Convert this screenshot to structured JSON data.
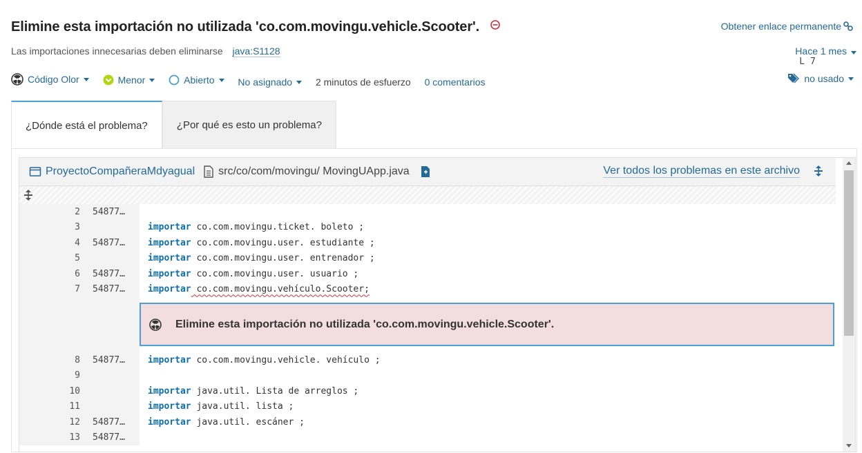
{
  "issue": {
    "title": "Elimine esta importación no utilizada 'co.com.movingu.vehicle.Scooter'.",
    "permalink_label": "Obtener enlace permanente",
    "description": "Las importaciones innecesarias deben eliminarse",
    "rule": "java:S1128",
    "date": "Hace 1 mes",
    "line": "L 7"
  },
  "meta": {
    "type": "Código Olor",
    "severity": "Menor",
    "status": "Abierto",
    "assignee": "No asignado",
    "effort": "2 minutos de esfuerzo",
    "comments": "0 comentarios",
    "tag": "no usado"
  },
  "tabs": [
    "¿Dónde está el problema?",
    "¿Por qué es esto un problema?"
  ],
  "code": {
    "project": "ProyectoCompañeraMdyagual",
    "path": "src/co/com/movingu/ MovingUApp.java",
    "see_all": "Ver todos los problemas en este archivo",
    "message": "Elimine esta importación no utilizada 'co.com.movingu.vehicle.Scooter'.",
    "lines_before": [
      {
        "n": "2",
        "scm": "54877…",
        "kw": "",
        "text": ""
      },
      {
        "n": "3",
        "scm": "",
        "kw": "importar",
        "text": " co.com.movingu.ticket. boleto ;"
      },
      {
        "n": "4",
        "scm": "54877…",
        "kw": "importar",
        "text": " co.com.movingu.user. estudiante ;"
      },
      {
        "n": "5",
        "scm": "",
        "kw": "importar",
        "text": " co.com.movingu.user. entrenador ;"
      },
      {
        "n": "6",
        "scm": "54877…",
        "kw": "importar",
        "text": " co.com.movingu.user. usuario ;"
      },
      {
        "n": "7",
        "scm": "54877…",
        "kw": "importar",
        "text": " co.com.movingu.vehículo.Scooter;"
      }
    ],
    "lines_after": [
      {
        "n": "8",
        "scm": "54877…",
        "kw": "importar",
        "text": " co.com.movingu.vehicle. vehículo ;"
      },
      {
        "n": "9",
        "scm": "",
        "kw": "",
        "text": ""
      },
      {
        "n": "10",
        "scm": "",
        "kw": "importar",
        "text": " java.util. Lista de arreglos ;"
      },
      {
        "n": "11",
        "scm": "",
        "kw": "importar",
        "text": " java.util. lista ;"
      },
      {
        "n": "12",
        "scm": "54877…",
        "kw": "importar",
        "text": " java.util. escáner ;"
      },
      {
        "n": "13",
        "scm": "54877…",
        "kw": "",
        "text": ""
      }
    ]
  },
  "colors": {
    "accent": "#236a97",
    "issue_bg": "#f2dede",
    "highlight": "#4b9fd5",
    "keyword": "#0b6fb0"
  },
  "icons": [
    "blocker-icon",
    "link-icon",
    "code-smell-icon",
    "severity-minor-icon",
    "status-open-icon",
    "tag-icon",
    "project-icon",
    "file-icon",
    "copy-icon",
    "expand-icon"
  ]
}
